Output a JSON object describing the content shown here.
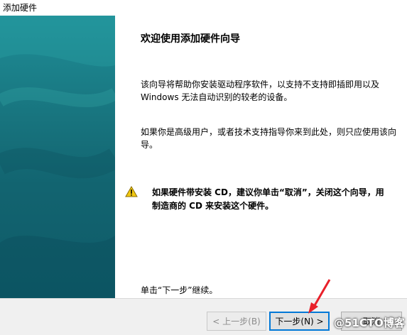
{
  "window": {
    "title": "添加硬件"
  },
  "wizard": {
    "heading": "欢迎使用添加硬件向导",
    "paragraph1": "该向导将帮助你安装驱动程序软件，以支持不支持即插即用以及 Windows 无法自动识别的较老的设备。",
    "paragraph2": "如果你是高级用户，或者技术支持指导你来到此处，则只应使用该向导。",
    "warning": "如果硬件带安装 CD，建议你单击“取消”，关闭这个向导，用制造商的 CD 来安装这个硬件。",
    "continue_hint": "单击“下一步”继续。"
  },
  "buttons": {
    "back": "< 上一步(B)",
    "next": "下一步(N) >",
    "cancel": "取消"
  },
  "watermark": "@51CTO博客",
  "colors": {
    "banner_top": "#1f8e97",
    "banner_bottom": "#0f5a68",
    "focus_border": "#0078d7",
    "annotation_arrow": "#e8202a",
    "warning_icon": "#f2c811"
  }
}
